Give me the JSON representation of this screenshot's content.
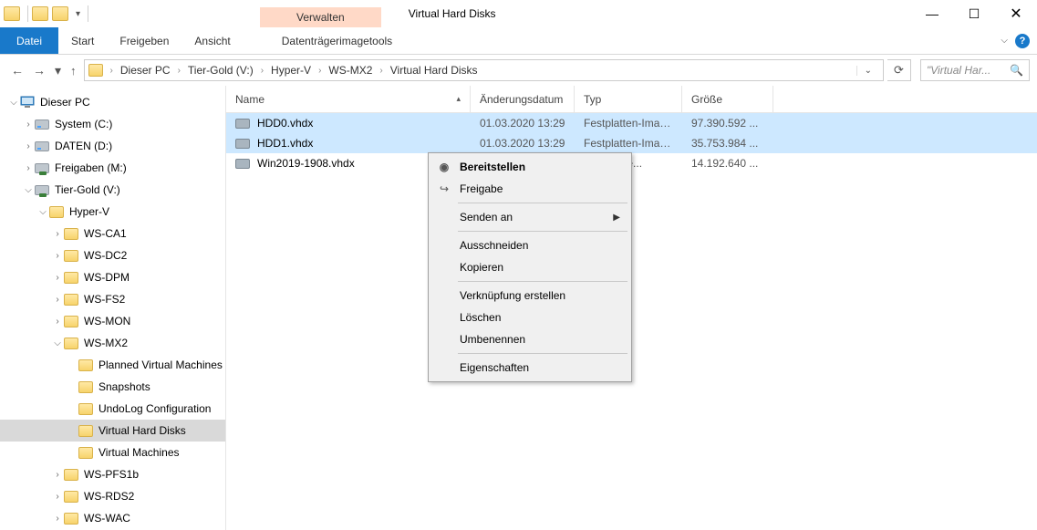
{
  "window": {
    "title": "Virtual Hard Disks",
    "context_tab_group": "Verwalten",
    "context_tab": "Datenträgerimagetools"
  },
  "ribbon": {
    "file": "Datei",
    "tabs": [
      "Start",
      "Freigeben",
      "Ansicht"
    ]
  },
  "breadcrumb": [
    "Dieser PC",
    "Tier-Gold (V:)",
    "Hyper-V",
    "WS-MX2",
    "Virtual Hard Disks"
  ],
  "search": {
    "placeholder": "\"Virtual Har..."
  },
  "tree": [
    {
      "label": "Dieser PC",
      "icon": "pc",
      "indent": 0,
      "exp": "v"
    },
    {
      "label": "System (C:)",
      "icon": "drive",
      "indent": 1,
      "exp": ">"
    },
    {
      "label": "DATEN (D:)",
      "icon": "drive",
      "indent": 1,
      "exp": ">"
    },
    {
      "label": "Freigaben (M:)",
      "icon": "netdrive",
      "indent": 1,
      "exp": ">"
    },
    {
      "label": "Tier-Gold (V:)",
      "icon": "netdrive",
      "indent": 1,
      "exp": "v"
    },
    {
      "label": "Hyper-V",
      "icon": "folder",
      "indent": 2,
      "exp": "v"
    },
    {
      "label": "WS-CA1",
      "icon": "folder",
      "indent": 3,
      "exp": ">"
    },
    {
      "label": "WS-DC2",
      "icon": "folder",
      "indent": 3,
      "exp": ">"
    },
    {
      "label": "WS-DPM",
      "icon": "folder",
      "indent": 3,
      "exp": ">"
    },
    {
      "label": "WS-FS2",
      "icon": "folder",
      "indent": 3,
      "exp": ">"
    },
    {
      "label": "WS-MON",
      "icon": "folder",
      "indent": 3,
      "exp": ">"
    },
    {
      "label": "WS-MX2",
      "icon": "folder",
      "indent": 3,
      "exp": "v"
    },
    {
      "label": "Planned Virtual Machines",
      "icon": "folder",
      "indent": 4
    },
    {
      "label": "Snapshots",
      "icon": "folder",
      "indent": 4
    },
    {
      "label": "UndoLog Configuration",
      "icon": "folder",
      "indent": 4
    },
    {
      "label": "Virtual Hard Disks",
      "icon": "folder",
      "indent": 4,
      "selected": true
    },
    {
      "label": "Virtual Machines",
      "icon": "folder",
      "indent": 4
    },
    {
      "label": "WS-PFS1b",
      "icon": "folder",
      "indent": 3,
      "exp": ">"
    },
    {
      "label": "WS-RDS2",
      "icon": "folder",
      "indent": 3,
      "exp": ">"
    },
    {
      "label": "WS-WAC",
      "icon": "folder",
      "indent": 3,
      "exp": ">"
    }
  ],
  "columns": {
    "name": "Name",
    "date": "Änderungsdatum",
    "type": "Typ",
    "size": "Größe"
  },
  "files": [
    {
      "name": "HDD0.vhdx",
      "date": "01.03.2020 13:29",
      "type": "Festplatten-Image...",
      "size": "97.390.592 ...",
      "selected": true
    },
    {
      "name": "HDD1.vhdx",
      "date": "01.03.2020 13:29",
      "type": "Festplatten-Image...",
      "size": "35.753.984 ...",
      "selected": true
    },
    {
      "name": "Win2019-1908.vhdx",
      "date": "",
      "type": "ten-Image...",
      "size": "14.192.640 ...",
      "selected": false
    }
  ],
  "context_menu": {
    "mount": "Bereitstellen",
    "share": "Freigabe",
    "sendto": "Senden an",
    "cut": "Ausschneiden",
    "copy": "Kopieren",
    "shortcut": "Verknüpfung erstellen",
    "delete": "Löschen",
    "rename": "Umbenennen",
    "properties": "Eigenschaften"
  }
}
